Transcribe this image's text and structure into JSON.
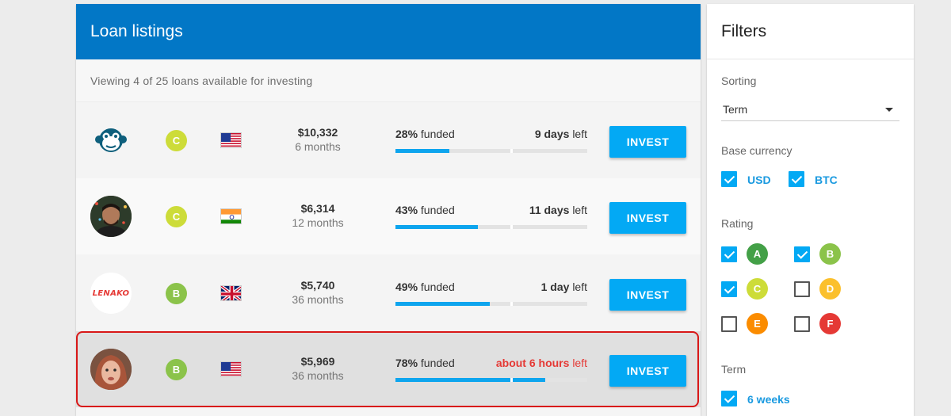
{
  "listings": {
    "title": "Loan listings",
    "subtitle": "Viewing 4 of 25 loans available for investing",
    "invest_label": "INVEST",
    "rows": [
      {
        "avatar": "monkey-logo",
        "rating": "C",
        "rating_color": "#cddc39",
        "country": "US",
        "amount": "$10,332",
        "term": "6 months",
        "pct": "28%",
        "funded_word": "funded",
        "remaining_value": "9 days",
        "remaining_suffix": "left",
        "progress": 0.28,
        "urgent": false
      },
      {
        "avatar": "user-photo-man",
        "rating": "C",
        "rating_color": "#cddc39",
        "country": "IN",
        "amount": "$6,314",
        "term": "12 months",
        "pct": "43%",
        "funded_word": "funded",
        "remaining_value": "11 days",
        "remaining_suffix": "left",
        "progress": 0.43,
        "urgent": false
      },
      {
        "avatar": "lenako-logo",
        "avatar_text": "LENAKO",
        "rating": "B",
        "rating_color": "#8bc34a",
        "country": "GB",
        "amount": "$5,740",
        "term": "36 months",
        "pct": "49%",
        "funded_word": "funded",
        "remaining_value": "1 day",
        "remaining_suffix": "left",
        "progress": 0.49,
        "urgent": false
      },
      {
        "avatar": "user-photo-woman",
        "rating": "B",
        "rating_color": "#8bc34a",
        "country": "US",
        "amount": "$5,969",
        "term": "36 months",
        "pct": "78%",
        "funded_word": "funded",
        "remaining_value": "about 6 hours",
        "remaining_suffix": "left",
        "progress": 0.78,
        "urgent": true
      }
    ]
  },
  "filters": {
    "title": "Filters",
    "sorting": {
      "label": "Sorting",
      "value": "Term"
    },
    "currency": {
      "label": "Base currency",
      "options": [
        {
          "label": "USD",
          "checked": true
        },
        {
          "label": "BTC",
          "checked": true
        }
      ]
    },
    "rating": {
      "label": "Rating",
      "options": [
        {
          "grade": "A",
          "color": "#43a047",
          "checked": true
        },
        {
          "grade": "B",
          "color": "#8bc34a",
          "checked": true
        },
        {
          "grade": "C",
          "color": "#cddc39",
          "checked": true
        },
        {
          "grade": "D",
          "color": "#fbc02d",
          "checked": false
        },
        {
          "grade": "E",
          "color": "#fb8c00",
          "checked": false
        },
        {
          "grade": "F",
          "color": "#e53935",
          "checked": false
        }
      ]
    },
    "term": {
      "label": "Term",
      "options": [
        {
          "label": "6 weeks",
          "checked": true
        }
      ]
    }
  },
  "colors": {
    "header": "#0277c6",
    "accent": "#03a9f4",
    "urgent": "#e53935",
    "selected_outline": "#d81818"
  }
}
